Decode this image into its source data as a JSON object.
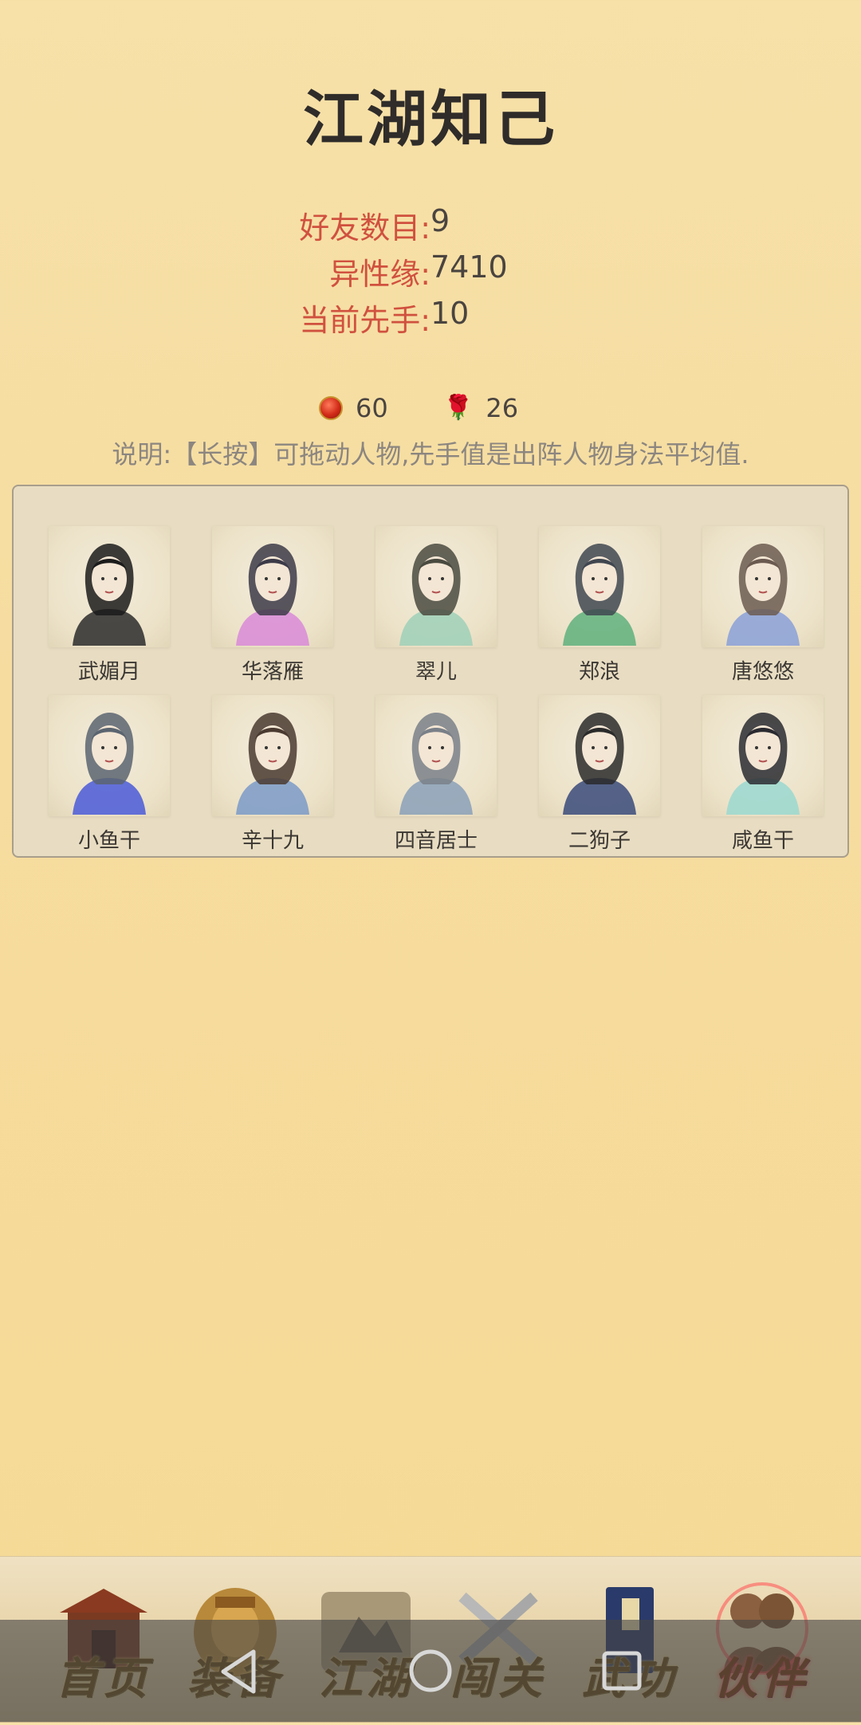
{
  "header": {
    "title": "江湖知己"
  },
  "stats": [
    {
      "label": "好友数目:",
      "value": "9"
    },
    {
      "label": "异性缘:",
      "value": "7410"
    },
    {
      "label": "当前先手:",
      "value": "10"
    }
  ],
  "resources": {
    "gourd": {
      "icon": "red-gourd-icon",
      "count": "60"
    },
    "rose": {
      "icon": "rose-icon",
      "count": "26"
    }
  },
  "hint": "说明:【长按】可拖动人物,先手值是出阵人物身法平均值.",
  "companions": [
    {
      "name": "武媚月",
      "hair": "#1b1b1b",
      "robe": "#2b2b2b"
    },
    {
      "name": "华落雁",
      "hair": "#3c3a48",
      "robe": "#d98ad8"
    },
    {
      "name": "翠儿",
      "hair": "#4a4a40",
      "robe": "#9fd0b8"
    },
    {
      "name": "郑浪",
      "hair": "#404650",
      "robe": "#5fb07c"
    },
    {
      "name": "唐悠悠",
      "hair": "#6b5a50",
      "robe": "#8aa0d8"
    },
    {
      "name": "小鱼干",
      "hair": "#5a6470",
      "robe": "#4a5ad8"
    },
    {
      "name": "辛十九",
      "hair": "#4a3a30",
      "robe": "#7a9ac8"
    },
    {
      "name": "四音居士",
      "hair": "#7a8088",
      "robe": "#8aa0b8"
    },
    {
      "name": "二狗子",
      "hair": "#2a2a2a",
      "robe": "#3a4a7a"
    },
    {
      "name": "咸鱼干",
      "hair": "#2a2a30",
      "robe": "#9ad8d0"
    }
  ],
  "tabs": [
    {
      "label": "首页",
      "icon": "gatehouse-icon"
    },
    {
      "label": "装备",
      "icon": "armor-icon"
    },
    {
      "label": "江湖",
      "icon": "map-scroll-icon"
    },
    {
      "label": "闯关",
      "icon": "crossed-swords-icon"
    },
    {
      "label": "武功",
      "icon": "book-icon"
    },
    {
      "label": "伙伴",
      "icon": "companions-icon"
    }
  ],
  "active_tab": "伙伴",
  "system_nav": [
    "back",
    "home",
    "recents"
  ]
}
